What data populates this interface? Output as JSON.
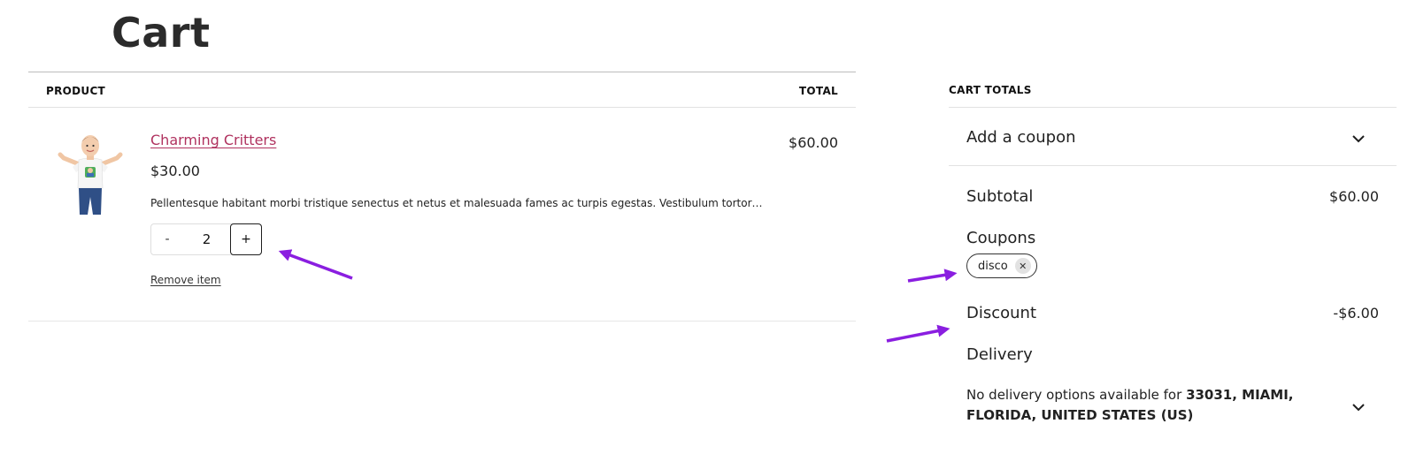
{
  "page": {
    "title": "Cart"
  },
  "cart_table": {
    "headers": {
      "product": "PRODUCT",
      "total": "TOTAL"
    },
    "items": [
      {
        "name": "Charming Critters",
        "price": "$30.00",
        "description": "Pellentesque habitant morbi tristique senectus et netus et malesuada fames ac turpis egestas. Vestibulum tortor…",
        "quantity": "2",
        "qty_minus_label": "-",
        "qty_plus_label": "+",
        "line_total": "$60.00",
        "remove_label": "Remove item"
      }
    ]
  },
  "totals": {
    "heading": "CART TOTALS",
    "coupon_toggle_label": "Add a coupon",
    "subtotal_label": "Subtotal",
    "subtotal_value": "$60.00",
    "coupons_label": "Coupons",
    "applied_coupon": "disco",
    "coupon_remove_glyph": "✕",
    "discount_label": "Discount",
    "discount_value": "-$6.00",
    "delivery_label": "Delivery",
    "delivery_note_prefix": "No delivery options available for ",
    "delivery_location": "33031, MIAMI, FLORIDA, UNITED STATES (US)"
  },
  "colors": {
    "product_link": "#b0325f",
    "annotation_arrow": "#8a1ee0",
    "chip_remove_bg": "#e2e2e2"
  },
  "icons": {
    "coupon_toggle": "chevron-down-icon",
    "delivery_toggle": "chevron-down-icon",
    "coupon_remove": "close-icon"
  }
}
